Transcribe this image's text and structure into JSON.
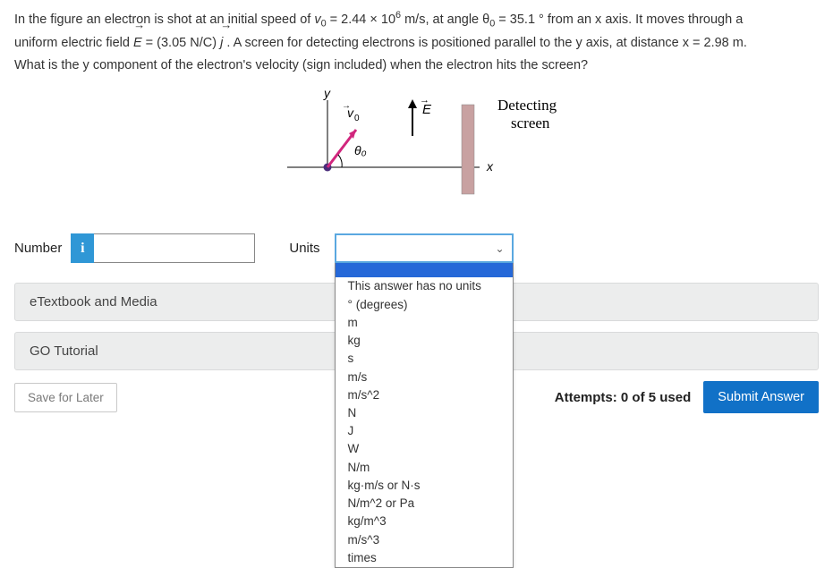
{
  "problem": {
    "text_1a": "In the figure an electron is shot at an initial speed of ",
    "v0_sym": "v",
    "v0_sub": "0",
    "eq1": " = 2.44 × 10",
    "exp6": "6",
    "text_1b": " m/s, at angle θ",
    "theta_sub": "0",
    "text_1c": " = 35.1 ° from an x axis. It moves through a",
    "text_2a": "uniform electric field ",
    "E_sym": "E",
    "E_val": " = (3.05 N/C) ",
    "j_sym": "j",
    "text_2b": " . A screen for detecting electrons is positioned parallel to the y axis, at distance x = 2.98 m.",
    "text_3": "What is the y component of the electron's velocity (sign included) when the electron hits the screen?"
  },
  "figure": {
    "y_label": "y",
    "x_label": "x",
    "v0_label": "v₀",
    "theta_label": "θ₀",
    "E_label": "E",
    "screen_label_1": "Detecting",
    "screen_label_2": "screen"
  },
  "answer": {
    "number_label": "Number",
    "info_badge": "i",
    "number_value": "",
    "units_label": "Units",
    "selected_unit": "",
    "options": [
      "This answer has no units",
      "° (degrees)",
      "m",
      "kg",
      "s",
      "m/s",
      "m/s^2",
      "N",
      "J",
      "W",
      "N/m",
      "kg·m/s or N·s",
      "N/m^2 or Pa",
      "kg/m^3",
      "m/s^3",
      "times"
    ]
  },
  "resources": {
    "etextbook": "eTextbook and Media",
    "go_tutorial": "GO Tutorial"
  },
  "footer": {
    "save": "Save for Later",
    "attempts": "Attempts: 0 of 5 used",
    "submit": "Submit Answer"
  }
}
